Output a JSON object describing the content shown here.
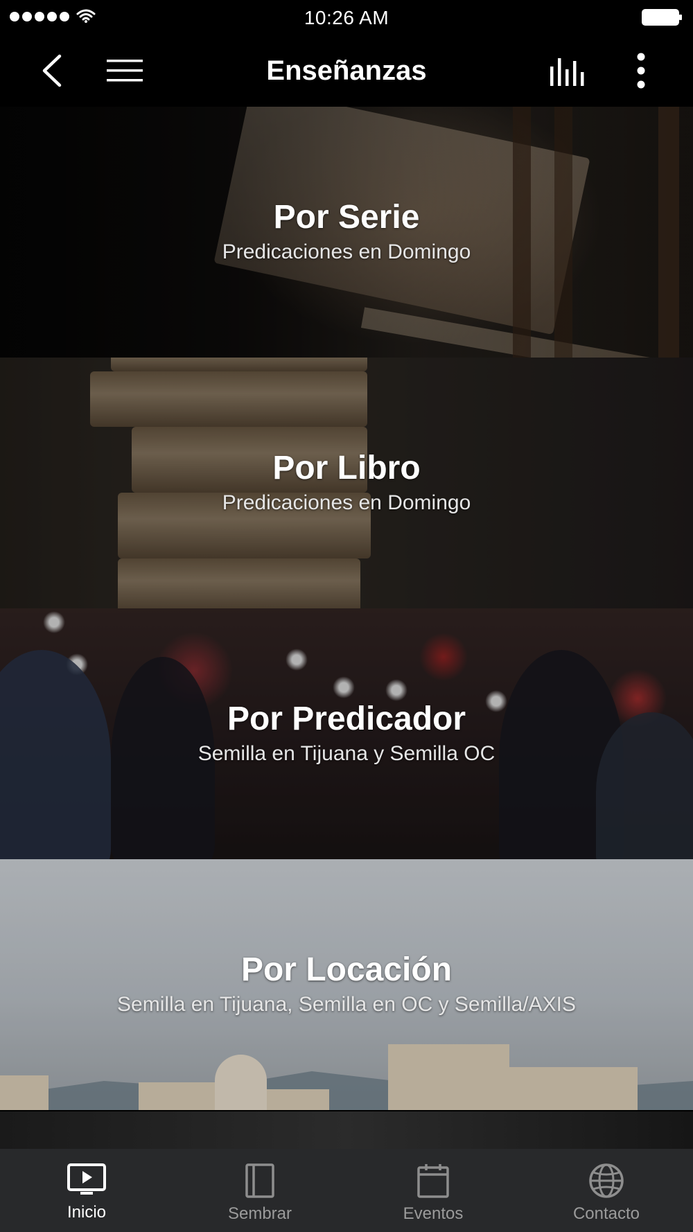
{
  "status_bar": {
    "time": "10:26 AM"
  },
  "nav": {
    "title": "Enseñanzas"
  },
  "cards": [
    {
      "title": "Por Serie",
      "subtitle": "Predicaciones en Domingo"
    },
    {
      "title": "Por Libro",
      "subtitle": "Predicaciones en Domingo"
    },
    {
      "title": "Por Predicador",
      "subtitle": "Semilla en Tijuana y Semilla OC"
    },
    {
      "title": "Por Locación",
      "subtitle": "Semilla en Tijuana, Semilla en OC y Semilla/AXIS"
    }
  ],
  "tabs": [
    {
      "label": "Inicio",
      "icon": "tv-play-icon",
      "active": true
    },
    {
      "label": "Sembrar",
      "icon": "book-icon",
      "active": false
    },
    {
      "label": "Eventos",
      "icon": "calendar-icon",
      "active": false
    },
    {
      "label": "Contacto",
      "icon": "globe-icon",
      "active": false
    }
  ],
  "colors": {
    "background": "#000000",
    "tab_bar": "#28292b",
    "tab_inactive": "#9b9b9b",
    "tab_active": "#ffffff"
  }
}
